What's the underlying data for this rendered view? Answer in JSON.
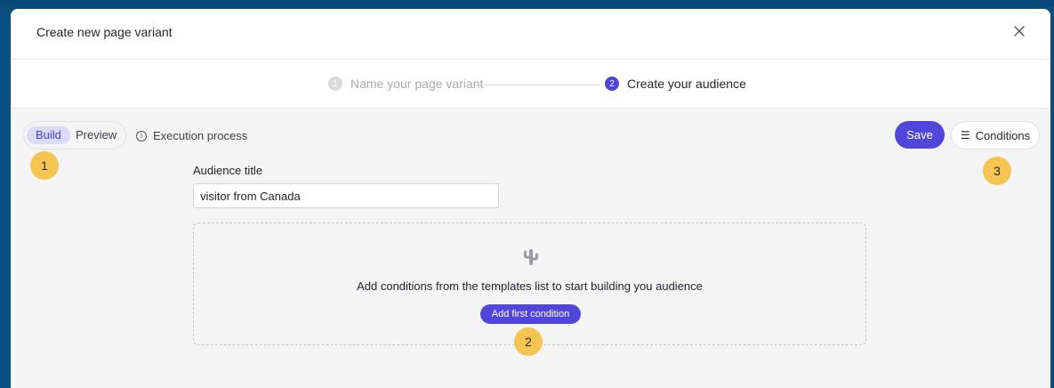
{
  "modal": {
    "title": "Create new page variant"
  },
  "stepper": {
    "steps": [
      {
        "number": "1",
        "label": "Name your page variant",
        "state": "completed"
      },
      {
        "number": "2",
        "label": "Create your audience",
        "state": "active"
      }
    ]
  },
  "toolbar": {
    "view_toggle": {
      "options": [
        "Build",
        "Preview"
      ],
      "selected": "Build"
    },
    "execution_label": "Execution process",
    "save_label": "Save",
    "conditions_label": "Conditions"
  },
  "form": {
    "audience_title_label": "Audience title",
    "audience_title_value": "visitor from Canada"
  },
  "empty_state": {
    "icon": "cactus-icon",
    "message": "Add conditions from the templates list to start building you audience",
    "button_label": "Add first condition"
  },
  "annotations": [
    "1",
    "2",
    "3"
  ],
  "colors": {
    "accent": "#5046d9",
    "badge": "#f6c451",
    "background": "#0b4f7e"
  }
}
